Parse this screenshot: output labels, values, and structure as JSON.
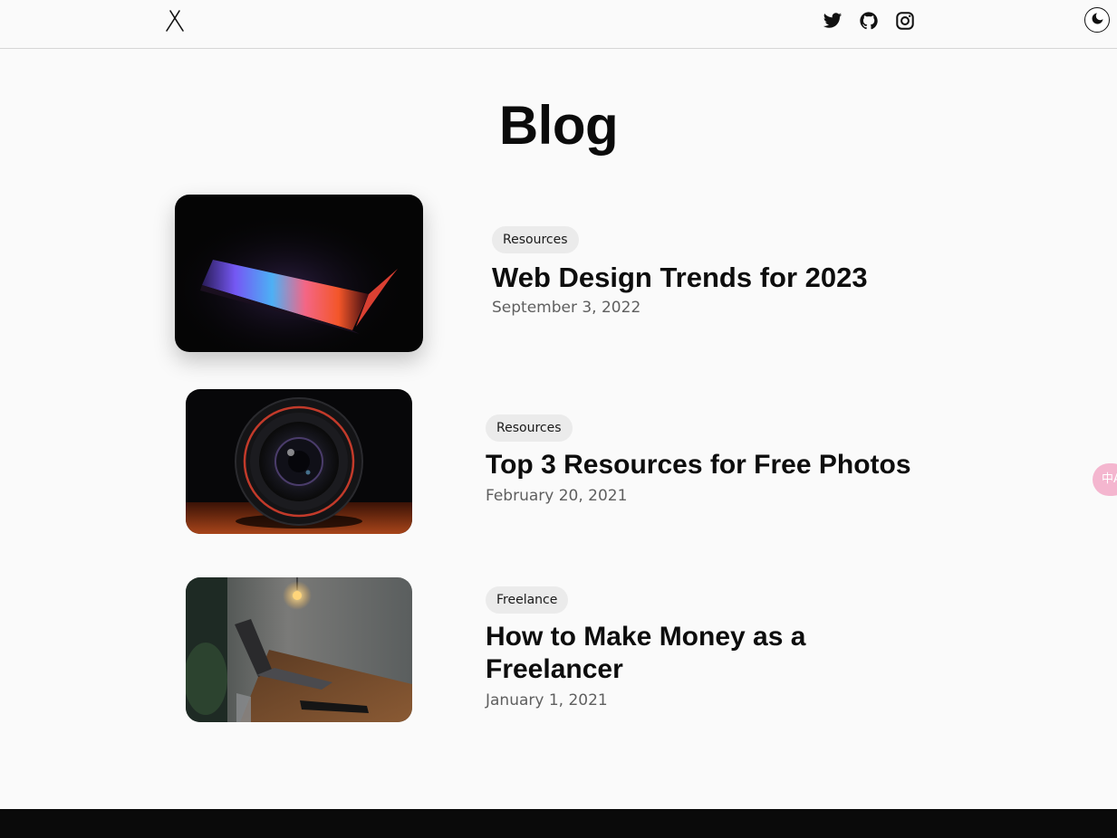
{
  "header": {
    "logo_icon": "x-logo-icon",
    "social": [
      {
        "name": "twitter",
        "icon": "twitter-icon"
      },
      {
        "name": "github",
        "icon": "github-icon"
      },
      {
        "name": "instagram",
        "icon": "instagram-icon"
      }
    ],
    "theme_toggle_icon": "moon-icon"
  },
  "page": {
    "title": "Blog"
  },
  "posts": [
    {
      "tag": "Resources",
      "title": "Web Design Trends for 2023",
      "date": "September 3, 2022",
      "image": "laptop-glow-image"
    },
    {
      "tag": "Resources",
      "title": "Top 3 Resources for Free Photos",
      "date": "February 20, 2021",
      "image": "camera-lens-image"
    },
    {
      "tag": "Freelance",
      "title": "How to Make Money as a Freelancer",
      "date": "January 1, 2021",
      "image": "desk-laptop-image"
    }
  ],
  "side_widget": {
    "text": "中A"
  },
  "colors": {
    "background": "#fafafa",
    "text": "#111111",
    "muted": "#5f5f5f",
    "tag_bg": "#ebebeb",
    "footer": "#0a0a0a",
    "widget": "#f4b6cf"
  }
}
